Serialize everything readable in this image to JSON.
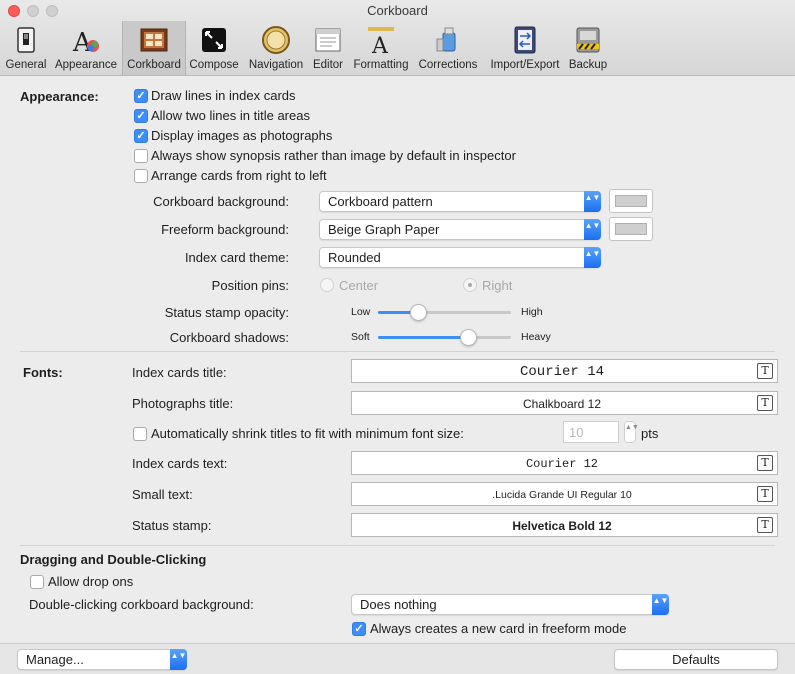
{
  "window": {
    "title": "Corkboard"
  },
  "toolbar": {
    "items": [
      {
        "label": "General",
        "icon": "switch-icon"
      },
      {
        "label": "Appearance",
        "icon": "appearance-icon"
      },
      {
        "label": "Corkboard",
        "icon": "corkboard-icon",
        "selected": true
      },
      {
        "label": "Compose",
        "icon": "compose-icon"
      },
      {
        "label": "Navigation",
        "icon": "compass-icon"
      },
      {
        "label": "Editor",
        "icon": "editor-icon"
      },
      {
        "label": "Formatting",
        "icon": "formatting-icon"
      },
      {
        "label": "Corrections",
        "icon": "corrections-icon"
      },
      {
        "label": "Import/Export",
        "icon": "import-export-icon"
      },
      {
        "label": "Backup",
        "icon": "backup-icon"
      }
    ]
  },
  "appearance": {
    "section_label": "Appearance:",
    "checkboxes": [
      {
        "label": "Draw lines in index cards",
        "checked": true
      },
      {
        "label": "Allow two lines in title areas",
        "checked": true
      },
      {
        "label": "Display images as photographs",
        "checked": true
      },
      {
        "label": "Always show synopsis rather than image by default in inspector",
        "checked": false
      },
      {
        "label": "Arrange cards from right to left",
        "checked": false
      }
    ],
    "corkboard_background": {
      "label": "Corkboard background:",
      "value": "Corkboard pattern"
    },
    "freeform_background": {
      "label": "Freeform background:",
      "value": "Beige Graph Paper"
    },
    "index_card_theme": {
      "label": "Index card theme:",
      "value": "Rounded"
    },
    "position_pins": {
      "label": "Position pins:",
      "options": [
        "Center",
        "Right"
      ],
      "selected": "Right"
    },
    "status_stamp_opacity": {
      "label": "Status stamp opacity:",
      "min_label": "Low",
      "max_label": "High",
      "value": 0.3
    },
    "corkboard_shadows": {
      "label": "Corkboard shadows:",
      "min_label": "Soft",
      "max_label": "Heavy",
      "value": 0.68
    }
  },
  "fonts": {
    "section_label": "Fonts:",
    "index_cards_title": {
      "label": "Index cards title:",
      "value": "Courier 14"
    },
    "photographs_title": {
      "label": "Photographs title:",
      "value": "Chalkboard 12"
    },
    "auto_shrink": {
      "label": "Automatically shrink titles to fit with minimum font size:",
      "checked": false,
      "value": "10",
      "unit": "pts"
    },
    "index_cards_text": {
      "label": "Index cards text:",
      "value": "Courier 12"
    },
    "small_text": {
      "label": "Small text:",
      "value": ".Lucida Grande UI Regular 10"
    },
    "status_stamp": {
      "label": "Status stamp:",
      "value": "Helvetica Bold 12"
    }
  },
  "dragging": {
    "section_label": "Dragging and Double-Clicking",
    "allow_drop_ons": {
      "label": "Allow drop ons",
      "checked": false
    },
    "double_click_bg": {
      "label": "Double-clicking corkboard background:",
      "value": "Does nothing"
    },
    "always_new_card": {
      "label": "Always creates a new card in freeform mode",
      "checked": true
    }
  },
  "bottom": {
    "manage": "Manage...",
    "defaults": "Defaults"
  },
  "icons": {
    "checkmark": "✓",
    "font_panel": "T",
    "popup_arrows": "▲▼"
  }
}
